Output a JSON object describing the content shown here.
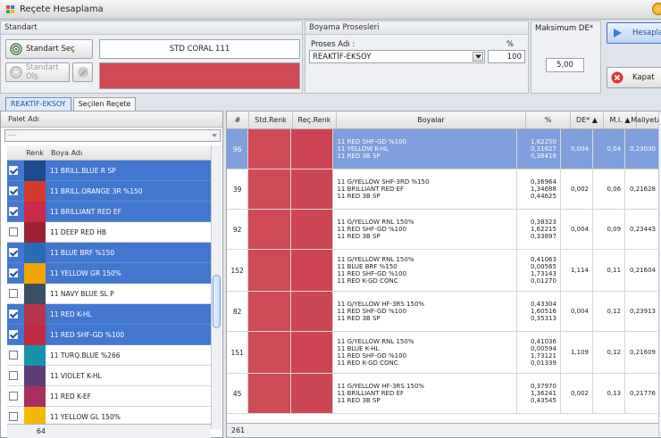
{
  "window": {
    "title": "Reçete Hesaplama"
  },
  "standart": {
    "header": "Standart",
    "select_label": "Standart Seç",
    "create_label": "Standart Olş",
    "name": "STD CORAL 111",
    "color": "#cf4a55"
  },
  "boyama": {
    "header": "Boyama Prosesleri",
    "proses_label": "Proses Adı :",
    "pct_label": "%",
    "proses_value": "REAKTİF-EKSOY",
    "pct_value": "100"
  },
  "maxde": {
    "header": "Maksimum DE*",
    "value": "5,00"
  },
  "actions": {
    "hesapla": "Hesapla",
    "kapat": "Kapat"
  },
  "tabs": [
    {
      "label": "REAKTİF-EKSOY",
      "active": true
    },
    {
      "label": "Seçilen Reçete",
      "active": false
    }
  ],
  "palet": {
    "header": "Palet Adı",
    "filter_value": "---",
    "col_renk": "Renk",
    "col_boya": "Boya Adı",
    "count": "64",
    "items": [
      {
        "name": "11 BRILL.BLUE R SP",
        "color": "#1b4a8f",
        "checked": true,
        "selected": true
      },
      {
        "name": "11 BRILL.ORANGE 3R %150",
        "color": "#d63a2c",
        "checked": true,
        "selected": true
      },
      {
        "name": "11 BRILLIANT RED EF",
        "color": "#cc2a4a",
        "checked": true,
        "selected": true
      },
      {
        "name": "11 DEEP RED HB",
        "color": "#9c2233",
        "checked": false,
        "selected": false
      },
      {
        "name": "11 BLUE BRF %150",
        "color": "#2a6bb5",
        "checked": true,
        "selected": true
      },
      {
        "name": "11 YELLOW GR 150%",
        "color": "#f0a500",
        "checked": true,
        "selected": true
      },
      {
        "name": "11 NAVY BLUE SL P",
        "color": "#3c4d66",
        "checked": false,
        "selected": false
      },
      {
        "name": "11 RED K-HL",
        "color": "#b8364c",
        "checked": true,
        "selected": true
      },
      {
        "name": "11 RED SHF-GD %100",
        "color": "#c22a45",
        "checked": true,
        "selected": true
      },
      {
        "name": "11 TURQ.BLUE %266",
        "color": "#1692a8",
        "checked": false,
        "selected": false
      },
      {
        "name": "11 VIOLET K-HL",
        "color": "#5d3c78",
        "checked": false,
        "selected": false
      },
      {
        "name": "11 RED K-EF",
        "color": "#a83060",
        "checked": false,
        "selected": false
      },
      {
        "name": "11 YELLOW GL 150%",
        "color": "#f5b800",
        "checked": false,
        "selected": false
      }
    ]
  },
  "recipes": {
    "columns": {
      "num": "#",
      "std": "Std.Renk",
      "req": "Reç.Renk",
      "boya": "Boyalar",
      "pct": "%",
      "de": "DE* ▲",
      "mi": "M.I. ▲",
      "maliyet": "Maliyet/kg"
    },
    "count": "261",
    "std_color": "#cf4a55",
    "rows": [
      {
        "num": "96",
        "color": "#cc4453",
        "selected": true,
        "dyes": [
          "11 RED SHF-GD %100",
          "11 YELLOW K-HL",
          "11 RED 3B SP"
        ],
        "pcts": [
          "1,62250",
          "0,31627",
          "0,36418"
        ],
        "de": "0,004",
        "mi": "0,04",
        "cost": "0,23030"
      },
      {
        "num": "39",
        "color": "#cd4654",
        "selected": false,
        "dyes": [
          "11 G/YELLOW SHF-3RD %150",
          "11 BRILLIANT RED EF",
          "11 RED 3B SP"
        ],
        "pcts": [
          "0,36964",
          "1,34688",
          "0,44625"
        ],
        "de": "0,002",
        "mi": "0,06",
        "cost": "0,21628"
      },
      {
        "num": "92",
        "color": "#cd4654",
        "selected": false,
        "dyes": [
          "11 G/YELLOW RNL 150%",
          "11 RED SHF-GD %100",
          "11 RED 3B SP"
        ],
        "pcts": [
          "0,38323",
          "1,62215",
          "0,33897"
        ],
        "de": "0,004",
        "mi": "0,09",
        "cost": "0,23443"
      },
      {
        "num": "152",
        "color": "#ce4452",
        "selected": false,
        "dyes": [
          "11 G/YELLOW RNL 150%",
          "11 BLUE BRF %150",
          "11 RED SHF-GD %100",
          "11 RED K-GD CONC"
        ],
        "pcts": [
          "0,41063",
          "0,00565",
          "1,73143",
          "0,01270"
        ],
        "de": "1,114",
        "mi": "0,11",
        "cost": "0,21604"
      },
      {
        "num": "82",
        "color": "#cd4654",
        "selected": false,
        "dyes": [
          "11 G/YELLOW HF-3RS 150%",
          "11 RED SHF-GD %100",
          "11 RED 3B SP"
        ],
        "pcts": [
          "0,43304",
          "1,60516",
          "0,35313"
        ],
        "de": "0,004",
        "mi": "0,12",
        "cost": "0,23913"
      },
      {
        "num": "151",
        "color": "#ce4452",
        "selected": false,
        "dyes": [
          "11 G/YELLOW RNL 150%",
          "11 BLUE K-HL",
          "11 RED SHF-GD %100",
          "11 RED K-GD CONC"
        ],
        "pcts": [
          "0,41036",
          "0,00594",
          "1,73121",
          "0,01339"
        ],
        "de": "1,109",
        "mi": "0,12",
        "cost": "0,21609"
      },
      {
        "num": "45",
        "color": "#cd4654",
        "selected": false,
        "dyes": [
          "11 G/YELLOW HF-3RS 150%",
          "11 BRILLIANT RED EF",
          "11 RED 3B SP"
        ],
        "pcts": [
          "0,37970",
          "1,36241",
          "0,43545"
        ],
        "de": "0,002",
        "mi": "0,13",
        "cost": "0,21776"
      }
    ]
  }
}
